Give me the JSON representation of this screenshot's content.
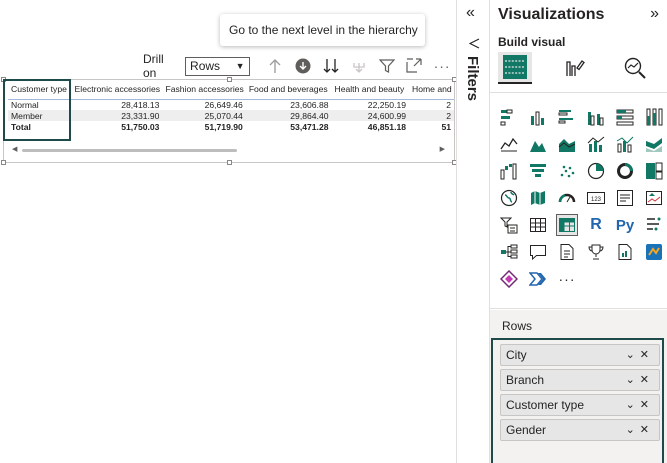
{
  "tooltip": "Go to the next level in the hierarchy",
  "toolbar": {
    "drill_on_label": "Drill on",
    "drill_on_value": "Rows",
    "icons": [
      "drill-up-icon",
      "drill-down-icon",
      "expand-next-level-icon",
      "expand-all-icon",
      "filter-icon",
      "focus-mode-icon",
      "more-options-icon"
    ]
  },
  "matrix": {
    "row_header": "Customer type",
    "columns": [
      "Electronic accessories",
      "Fashion accessories",
      "Food and beverages",
      "Health and beauty",
      "Home and"
    ],
    "rows": [
      {
        "label": "Normal",
        "values": [
          "28,418.13",
          "26,649.46",
          "23,606.88",
          "22,250.19",
          "2"
        ]
      },
      {
        "label": "Member",
        "values": [
          "23,331.90",
          "25,070.44",
          "29,864.40",
          "24,600.99",
          "2"
        ]
      }
    ],
    "total": {
      "label": "Total",
      "values": [
        "51,750.03",
        "51,719.90",
        "53,471.28",
        "46,851.18",
        "51"
      ]
    }
  },
  "filters": {
    "label": "Filters",
    "collapse_icon": "double-chevron-left-icon"
  },
  "viz_pane": {
    "title": "Visualizations",
    "build_visual_label": "Build visual",
    "tabs": [
      "build-visual-icon",
      "format-visual-icon",
      "analytics-icon"
    ],
    "rows_label": "Rows",
    "row_fields": [
      "City",
      "Branch",
      "Customer type",
      "Gender"
    ],
    "more_label": "···"
  },
  "colors": {
    "highlight": "#1e4a4a",
    "accent": "#118dff",
    "pane_bg": "#f3f2f1"
  }
}
